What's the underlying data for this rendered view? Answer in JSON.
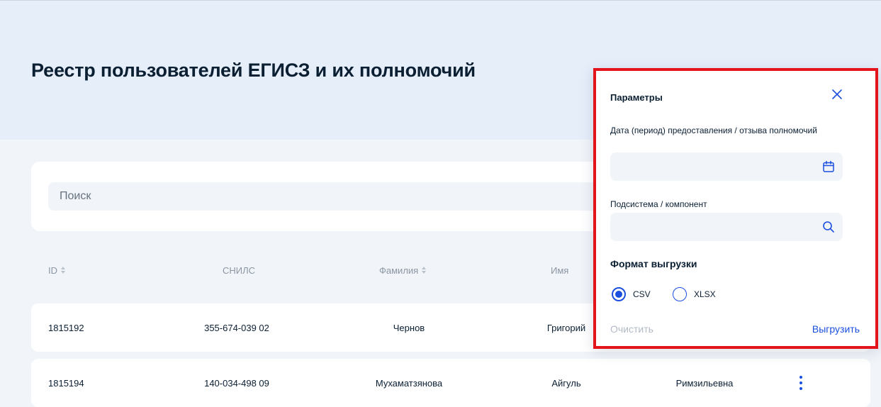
{
  "page": {
    "title": "Реестр пользователей ЕГИСЗ и их полномочий"
  },
  "search": {
    "placeholder": "Поиск"
  },
  "table": {
    "columns": [
      "ID",
      "СНИЛС",
      "Фамилия",
      "Имя"
    ],
    "rows": [
      {
        "id": "1815192",
        "snils": "355-674-039 02",
        "surname": "Чернов",
        "name": "Григорий",
        "patronymic": ""
      },
      {
        "id": "1815194",
        "snils": "140-034-498 09",
        "surname": "Мухаматзянова",
        "name": "Айгуль",
        "patronymic": "Римзильевна"
      }
    ]
  },
  "panel": {
    "title": "Параметры",
    "date_label": "Дата (период) предоставления / отзыва полномочий",
    "date_value": "",
    "subsystem_label": "Подсистема / компонент",
    "subsystem_value": "",
    "format_title": "Формат выгрузки",
    "formats": [
      {
        "label": "CSV",
        "selected": true
      },
      {
        "label": "XLSX",
        "selected": false
      }
    ],
    "clear_label": "Очистить",
    "export_label": "Выгрузить"
  },
  "colors": {
    "accent": "#1b4fe0",
    "highlight_border": "#e3141c",
    "header_band": "#e6eefa"
  },
  "icons": [
    "close-icon",
    "calendar-icon",
    "search-icon",
    "sort-icon",
    "more-vertical-icon"
  ]
}
